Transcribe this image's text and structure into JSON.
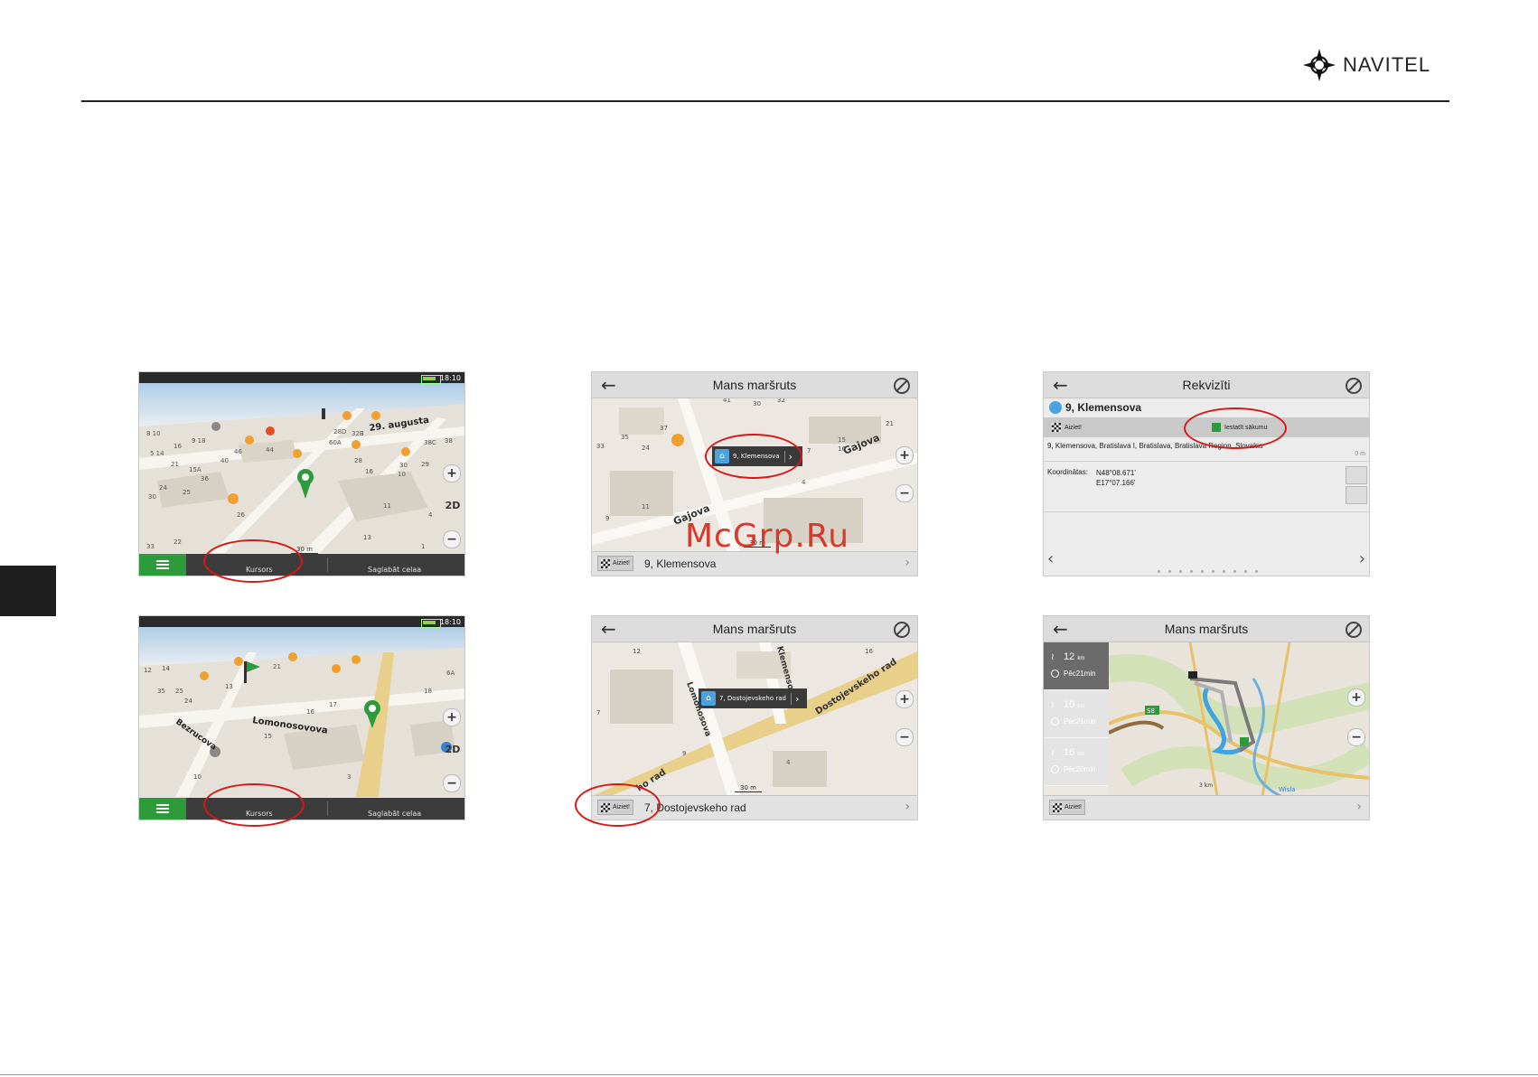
{
  "brand": {
    "name": "NAVITEL"
  },
  "watermark": "McGrp.Ru",
  "shots": {
    "s1": {
      "status_time": "18:10",
      "street": "29. augusta",
      "scale": "30 m",
      "toolbar": {
        "cursor": "Kursors",
        "save": "Saglabāt celaa"
      },
      "zoom_in": "+",
      "zoom_out": "−",
      "mode": "2D",
      "numbers": [
        "2",
        "8 10",
        "16",
        "9 18",
        "5 14",
        "15",
        "21",
        "15A",
        "36",
        "30",
        "25",
        "24",
        "3",
        "33",
        "22",
        "28D",
        "60A",
        "32B",
        "28",
        "21",
        "46",
        "44",
        "40",
        "23",
        "37",
        "26",
        "39",
        "2",
        "17",
        "13",
        "10",
        "15",
        "16",
        "29",
        "30",
        "32",
        "38C",
        "38",
        "11",
        "3",
        "13",
        "1",
        "4",
        "6",
        "4"
      ]
    },
    "s2": {
      "title": "Mans maršruts",
      "callout": "9, Klemensova",
      "street": "Gajova",
      "street2": "Gajova",
      "scale": "30 m",
      "go_label": "Aiziet!",
      "address": "9, Klemensova",
      "numbers": [
        "41",
        "32",
        "33",
        "30",
        "37",
        "35",
        "24",
        "33",
        "21",
        "15",
        "16",
        "7",
        "11",
        "9",
        "4"
      ]
    },
    "s3": {
      "title": "Rekvizīti",
      "name": "9, Klemensova",
      "go_label": "Aiziet!",
      "start_label": "Iestatīt sākumu",
      "address": "9, Klemensova, Bratislava I, Bratislava, Bratislava Region, Slovakia",
      "distance": "0 m",
      "coord_label": "Koordinātas:",
      "lat": "N48°08.671'",
      "lon": "E17°07.166'"
    },
    "s4": {
      "status_time": "18:10",
      "street": "Lomonosovova",
      "street2": "Bezrucova",
      "toolbar": {
        "cursor": "Kursors",
        "save": "Saglabāt celaa"
      },
      "zoom_in": "+",
      "zoom_out": "−",
      "mode": "2D",
      "numbers": [
        "12",
        "14",
        "25",
        "35",
        "24",
        "3",
        "13",
        "11",
        "8",
        "21",
        "6A",
        "18",
        "10",
        "2",
        "12",
        "13",
        "15",
        "17",
        "19",
        "21",
        "16",
        "7",
        "4",
        "6"
      ]
    },
    "s5": {
      "title": "Mans maršruts",
      "callout": "7, Dostojevskeho rad",
      "street": "Dostojevskeho rad",
      "street2": "Lomonosova",
      "street3": "Klemensova",
      "street4": "ho rad",
      "scale": "30 m",
      "go_label": "Aiziet!",
      "address": "7, Dostojevskeho rad",
      "numbers": [
        "12",
        "16",
        "7",
        "9",
        "4"
      ]
    },
    "s6": {
      "title": "Mans maršruts",
      "go_label": "Aiziet!",
      "routes": [
        {
          "km": "12",
          "unit": "km",
          "time": "Pēc21min"
        },
        {
          "km": "10",
          "unit": "km",
          "time": "Pēc21min"
        },
        {
          "km": "16",
          "unit": "km",
          "time": "Pēc20min"
        }
      ],
      "scale": "3 km",
      "road_tag": "S8",
      "river": "Wisla"
    }
  },
  "colors": {
    "highlight": "#d81818",
    "accent_green": "#2e9b3a",
    "watermark": "#d63a2c"
  }
}
